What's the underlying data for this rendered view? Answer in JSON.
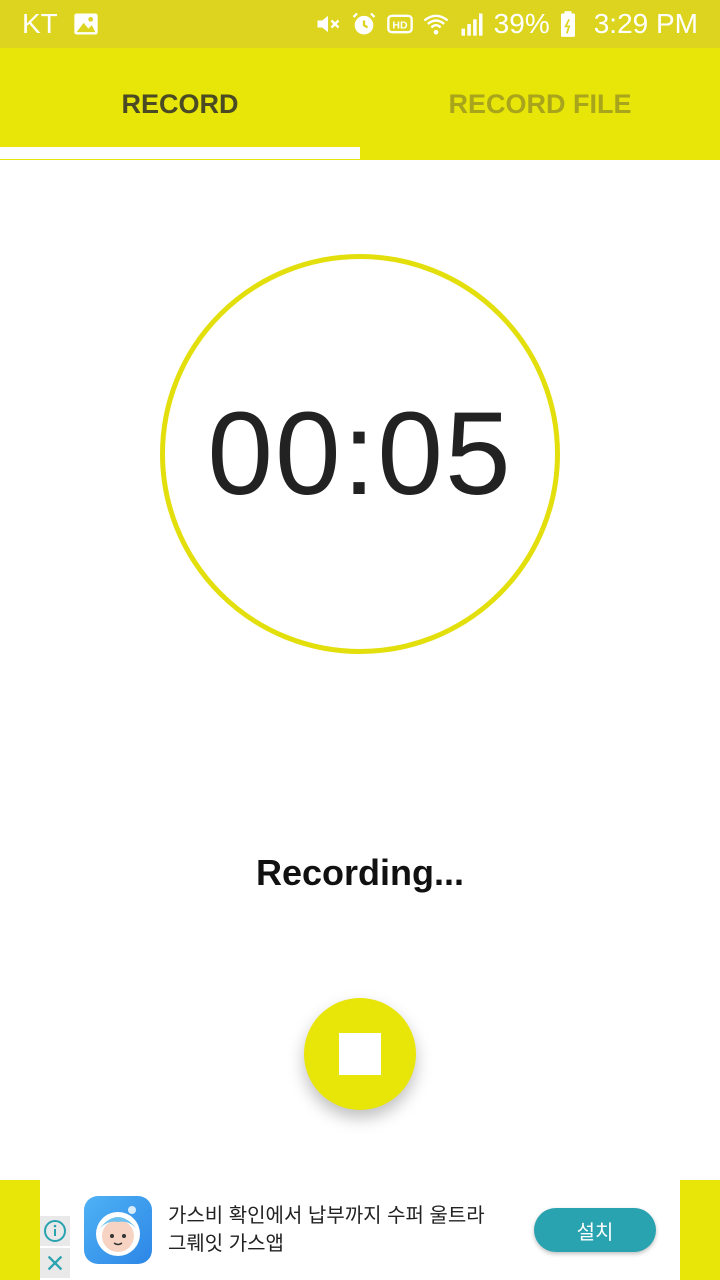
{
  "status_bar": {
    "carrier": "KT",
    "battery": "39%",
    "time": "3:29 PM",
    "icons": [
      "image-icon",
      "mute-icon",
      "alarm-icon",
      "hd-icon",
      "wifi-icon",
      "signal-icon",
      "battery-icon"
    ]
  },
  "tabs": [
    {
      "label": "RECORD",
      "active": true
    },
    {
      "label": "RECORD FILE",
      "active": false
    }
  ],
  "timer": {
    "value": "00:05"
  },
  "status": {
    "text": "Recording..."
  },
  "controls": {
    "stop_icon": "stop-icon"
  },
  "ad": {
    "text_line1": "가스비 확인에서 납부까지 수퍼 울트라",
    "text_line2": "그뤠잇 가스앱",
    "install_label": "설치"
  },
  "colors": {
    "accent": "#e8e508",
    "status_bar": "#dcd41e",
    "install": "#2aa3b0"
  }
}
